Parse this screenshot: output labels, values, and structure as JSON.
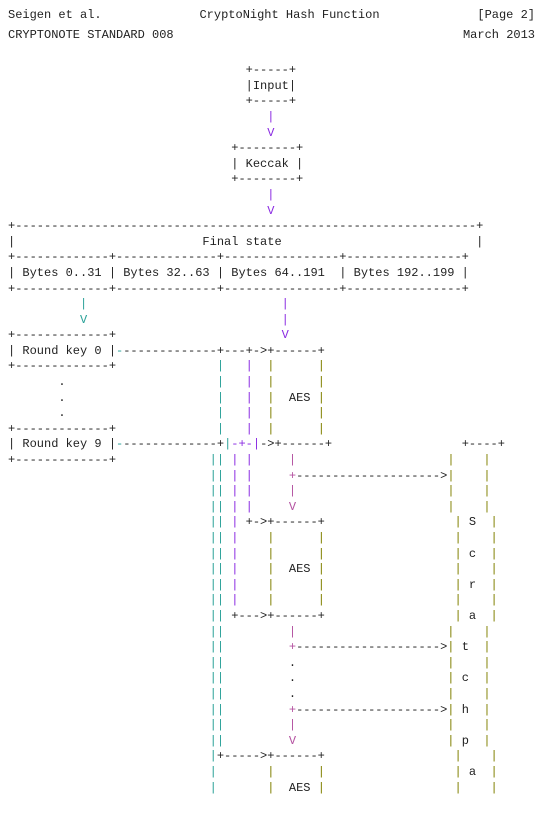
{
  "header": {
    "left": "Seigen et al.",
    "center": "CryptoNight Hash Function",
    "right": "[Page 2]"
  },
  "subheader": {
    "left": "CRYPTONOTE STANDARD 008",
    "right": "March 2013"
  },
  "diagram": {
    "input": "Input",
    "keccak": "Keccak",
    "final_state": "Final state",
    "bytes0": "Bytes 0..31",
    "bytes1": "Bytes 32..63",
    "bytes2": "Bytes 64..191",
    "bytes3": "Bytes 192..199",
    "rk0": "Round key 0",
    "rk9": "Round key 9",
    "aes": "AES",
    "scratchpad_chars": [
      "S",
      "c",
      "r",
      "a",
      "t",
      "c",
      "h",
      "p",
      "a"
    ]
  }
}
